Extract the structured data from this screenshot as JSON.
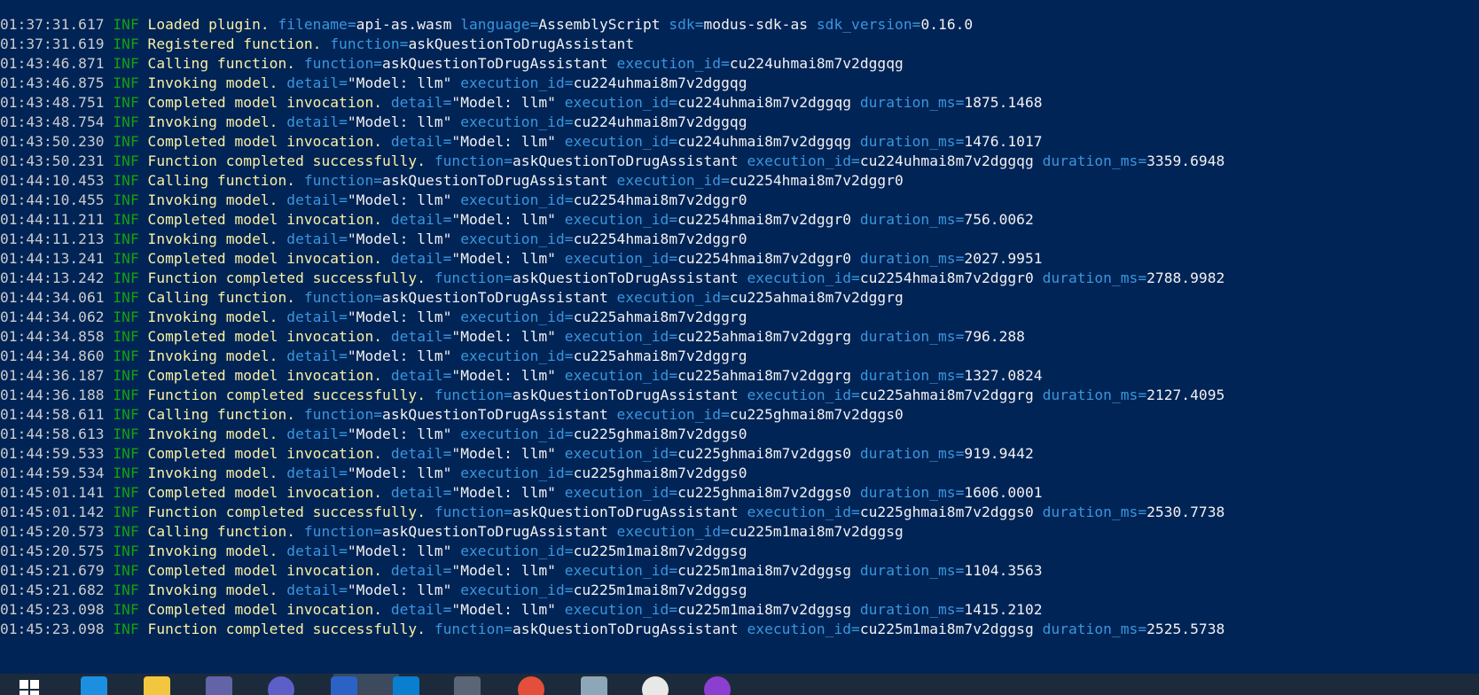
{
  "log": {
    "lines": [
      {
        "ts": "01:37:31.617",
        "level": "INF",
        "msg": "Loaded plugin.",
        "fields": [
          {
            "k": "filename",
            "v": "api-as.wasm"
          },
          {
            "k": "language",
            "v": "AssemblyScript"
          },
          {
            "k": "sdk",
            "v": "modus-sdk-as"
          },
          {
            "k": "sdk_version",
            "v": "0.16.0"
          }
        ]
      },
      {
        "ts": "01:37:31.619",
        "level": "INF",
        "msg": "Registered function.",
        "fields": [
          {
            "k": "function",
            "v": "askQuestionToDrugAssistant"
          }
        ]
      },
      {
        "ts": "01:43:46.871",
        "level": "INF",
        "msg": "Calling function.",
        "fields": [
          {
            "k": "function",
            "v": "askQuestionToDrugAssistant"
          },
          {
            "k": "execution_id",
            "v": "cu224uhmai8m7v2dggqg"
          }
        ]
      },
      {
        "ts": "01:43:46.875",
        "level": "INF",
        "msg": "Invoking model.",
        "fields": [
          {
            "k": "detail",
            "v": "\"Model: llm\""
          },
          {
            "k": "execution_id",
            "v": "cu224uhmai8m7v2dggqg"
          }
        ]
      },
      {
        "ts": "01:43:48.751",
        "level": "INF",
        "msg": "Completed model invocation.",
        "fields": [
          {
            "k": "detail",
            "v": "\"Model: llm\""
          },
          {
            "k": "execution_id",
            "v": "cu224uhmai8m7v2dggqg"
          },
          {
            "k": "duration_ms",
            "v": "1875.1468"
          }
        ]
      },
      {
        "ts": "01:43:48.754",
        "level": "INF",
        "msg": "Invoking model.",
        "fields": [
          {
            "k": "detail",
            "v": "\"Model: llm\""
          },
          {
            "k": "execution_id",
            "v": "cu224uhmai8m7v2dggqg"
          }
        ]
      },
      {
        "ts": "01:43:50.230",
        "level": "INF",
        "msg": "Completed model invocation.",
        "fields": [
          {
            "k": "detail",
            "v": "\"Model: llm\""
          },
          {
            "k": "execution_id",
            "v": "cu224uhmai8m7v2dggqg"
          },
          {
            "k": "duration_ms",
            "v": "1476.1017"
          }
        ]
      },
      {
        "ts": "01:43:50.231",
        "level": "INF",
        "msg": "Function completed successfully.",
        "fields": [
          {
            "k": "function",
            "v": "askQuestionToDrugAssistant"
          },
          {
            "k": "execution_id",
            "v": "cu224uhmai8m7v2dggqg"
          },
          {
            "k": "duration_ms",
            "v": "3359.6948"
          }
        ]
      },
      {
        "ts": "01:44:10.453",
        "level": "INF",
        "msg": "Calling function.",
        "fields": [
          {
            "k": "function",
            "v": "askQuestionToDrugAssistant"
          },
          {
            "k": "execution_id",
            "v": "cu2254hmai8m7v2dggr0"
          }
        ]
      },
      {
        "ts": "01:44:10.455",
        "level": "INF",
        "msg": "Invoking model.",
        "fields": [
          {
            "k": "detail",
            "v": "\"Model: llm\""
          },
          {
            "k": "execution_id",
            "v": "cu2254hmai8m7v2dggr0"
          }
        ]
      },
      {
        "ts": "01:44:11.211",
        "level": "INF",
        "msg": "Completed model invocation.",
        "fields": [
          {
            "k": "detail",
            "v": "\"Model: llm\""
          },
          {
            "k": "execution_id",
            "v": "cu2254hmai8m7v2dggr0"
          },
          {
            "k": "duration_ms",
            "v": "756.0062"
          }
        ]
      },
      {
        "ts": "01:44:11.213",
        "level": "INF",
        "msg": "Invoking model.",
        "fields": [
          {
            "k": "detail",
            "v": "\"Model: llm\""
          },
          {
            "k": "execution_id",
            "v": "cu2254hmai8m7v2dggr0"
          }
        ]
      },
      {
        "ts": "01:44:13.241",
        "level": "INF",
        "msg": "Completed model invocation.",
        "fields": [
          {
            "k": "detail",
            "v": "\"Model: llm\""
          },
          {
            "k": "execution_id",
            "v": "cu2254hmai8m7v2dggr0"
          },
          {
            "k": "duration_ms",
            "v": "2027.9951"
          }
        ]
      },
      {
        "ts": "01:44:13.242",
        "level": "INF",
        "msg": "Function completed successfully.",
        "fields": [
          {
            "k": "function",
            "v": "askQuestionToDrugAssistant"
          },
          {
            "k": "execution_id",
            "v": "cu2254hmai8m7v2dggr0"
          },
          {
            "k": "duration_ms",
            "v": "2788.9982"
          }
        ]
      },
      {
        "ts": "01:44:34.061",
        "level": "INF",
        "msg": "Calling function.",
        "fields": [
          {
            "k": "function",
            "v": "askQuestionToDrugAssistant"
          },
          {
            "k": "execution_id",
            "v": "cu225ahmai8m7v2dggrg"
          }
        ]
      },
      {
        "ts": "01:44:34.062",
        "level": "INF",
        "msg": "Invoking model.",
        "fields": [
          {
            "k": "detail",
            "v": "\"Model: llm\""
          },
          {
            "k": "execution_id",
            "v": "cu225ahmai8m7v2dggrg"
          }
        ]
      },
      {
        "ts": "01:44:34.858",
        "level": "INF",
        "msg": "Completed model invocation.",
        "fields": [
          {
            "k": "detail",
            "v": "\"Model: llm\""
          },
          {
            "k": "execution_id",
            "v": "cu225ahmai8m7v2dggrg"
          },
          {
            "k": "duration_ms",
            "v": "796.288"
          }
        ]
      },
      {
        "ts": "01:44:34.860",
        "level": "INF",
        "msg": "Invoking model.",
        "fields": [
          {
            "k": "detail",
            "v": "\"Model: llm\""
          },
          {
            "k": "execution_id",
            "v": "cu225ahmai8m7v2dggrg"
          }
        ]
      },
      {
        "ts": "01:44:36.187",
        "level": "INF",
        "msg": "Completed model invocation.",
        "fields": [
          {
            "k": "detail",
            "v": "\"Model: llm\""
          },
          {
            "k": "execution_id",
            "v": "cu225ahmai8m7v2dggrg"
          },
          {
            "k": "duration_ms",
            "v": "1327.0824"
          }
        ]
      },
      {
        "ts": "01:44:36.188",
        "level": "INF",
        "msg": "Function completed successfully.",
        "fields": [
          {
            "k": "function",
            "v": "askQuestionToDrugAssistant"
          },
          {
            "k": "execution_id",
            "v": "cu225ahmai8m7v2dggrg"
          },
          {
            "k": "duration_ms",
            "v": "2127.4095"
          }
        ]
      },
      {
        "ts": "01:44:58.611",
        "level": "INF",
        "msg": "Calling function.",
        "fields": [
          {
            "k": "function",
            "v": "askQuestionToDrugAssistant"
          },
          {
            "k": "execution_id",
            "v": "cu225ghmai8m7v2dggs0"
          }
        ]
      },
      {
        "ts": "01:44:58.613",
        "level": "INF",
        "msg": "Invoking model.",
        "fields": [
          {
            "k": "detail",
            "v": "\"Model: llm\""
          },
          {
            "k": "execution_id",
            "v": "cu225ghmai8m7v2dggs0"
          }
        ]
      },
      {
        "ts": "01:44:59.533",
        "level": "INF",
        "msg": "Completed model invocation.",
        "fields": [
          {
            "k": "detail",
            "v": "\"Model: llm\""
          },
          {
            "k": "execution_id",
            "v": "cu225ghmai8m7v2dggs0"
          },
          {
            "k": "duration_ms",
            "v": "919.9442"
          }
        ]
      },
      {
        "ts": "01:44:59.534",
        "level": "INF",
        "msg": "Invoking model.",
        "fields": [
          {
            "k": "detail",
            "v": "\"Model: llm\""
          },
          {
            "k": "execution_id",
            "v": "cu225ghmai8m7v2dggs0"
          }
        ]
      },
      {
        "ts": "01:45:01.141",
        "level": "INF",
        "msg": "Completed model invocation.",
        "fields": [
          {
            "k": "detail",
            "v": "\"Model: llm\""
          },
          {
            "k": "execution_id",
            "v": "cu225ghmai8m7v2dggs0"
          },
          {
            "k": "duration_ms",
            "v": "1606.0001"
          }
        ]
      },
      {
        "ts": "01:45:01.142",
        "level": "INF",
        "msg": "Function completed successfully.",
        "fields": [
          {
            "k": "function",
            "v": "askQuestionToDrugAssistant"
          },
          {
            "k": "execution_id",
            "v": "cu225ghmai8m7v2dggs0"
          },
          {
            "k": "duration_ms",
            "v": "2530.7738"
          }
        ]
      },
      {
        "ts": "01:45:20.573",
        "level": "INF",
        "msg": "Calling function.",
        "fields": [
          {
            "k": "function",
            "v": "askQuestionToDrugAssistant"
          },
          {
            "k": "execution_id",
            "v": "cu225m1mai8m7v2dggsg"
          }
        ]
      },
      {
        "ts": "01:45:20.575",
        "level": "INF",
        "msg": "Invoking model.",
        "fields": [
          {
            "k": "detail",
            "v": "\"Model: llm\""
          },
          {
            "k": "execution_id",
            "v": "cu225m1mai8m7v2dggsg"
          }
        ]
      },
      {
        "ts": "01:45:21.679",
        "level": "INF",
        "msg": "Completed model invocation.",
        "fields": [
          {
            "k": "detail",
            "v": "\"Model: llm\""
          },
          {
            "k": "execution_id",
            "v": "cu225m1mai8m7v2dggsg"
          },
          {
            "k": "duration_ms",
            "v": "1104.3563"
          }
        ]
      },
      {
        "ts": "01:45:21.682",
        "level": "INF",
        "msg": "Invoking model.",
        "fields": [
          {
            "k": "detail",
            "v": "\"Model: llm\""
          },
          {
            "k": "execution_id",
            "v": "cu225m1mai8m7v2dggsg"
          }
        ]
      },
      {
        "ts": "01:45:23.098",
        "level": "INF",
        "msg": "Completed model invocation.",
        "fields": [
          {
            "k": "detail",
            "v": "\"Model: llm\""
          },
          {
            "k": "execution_id",
            "v": "cu225m1mai8m7v2dggsg"
          },
          {
            "k": "duration_ms",
            "v": "1415.2102"
          }
        ]
      },
      {
        "ts": "01:45:23.098",
        "level": "INF",
        "msg": "Function completed successfully.",
        "fields": [
          {
            "k": "function",
            "v": "askQuestionToDrugAssistant"
          },
          {
            "k": "execution_id",
            "v": "cu225m1mai8m7v2dggsg"
          },
          {
            "k": "duration_ms",
            "v": "2525.5738"
          }
        ]
      }
    ]
  },
  "colors": {
    "background": "#012456",
    "timestamp": "#cccccc",
    "level": "#13a10e",
    "message": "#f9f1a5",
    "field_key": "#3a96dd",
    "field_value": "#f2f2f2"
  },
  "taskbar": {
    "icons": [
      {
        "name": "windows-start-icon",
        "color": "#ffffff"
      },
      {
        "name": "edge-browser-icon",
        "color": "#1d8fe0"
      },
      {
        "name": "file-explorer-icon",
        "color": "#f3c63f"
      },
      {
        "name": "teams-icon",
        "color": "#6264a7"
      },
      {
        "name": "chat-app-icon",
        "color": "#5b5fc7"
      },
      {
        "name": "terminal-icon",
        "color": "#2b62c5"
      },
      {
        "name": "vscode-icon",
        "color": "#0a7ecf"
      },
      {
        "name": "window-app-icon",
        "color": "#5a6675"
      },
      {
        "name": "chrome-icon",
        "color": "#e34f3a"
      },
      {
        "name": "notepad-icon",
        "color": "#8ea7b8"
      },
      {
        "name": "browser-circle-icon",
        "color": "#e8e8e8"
      },
      {
        "name": "purple-app-icon",
        "color": "#8b3fd1"
      }
    ]
  }
}
